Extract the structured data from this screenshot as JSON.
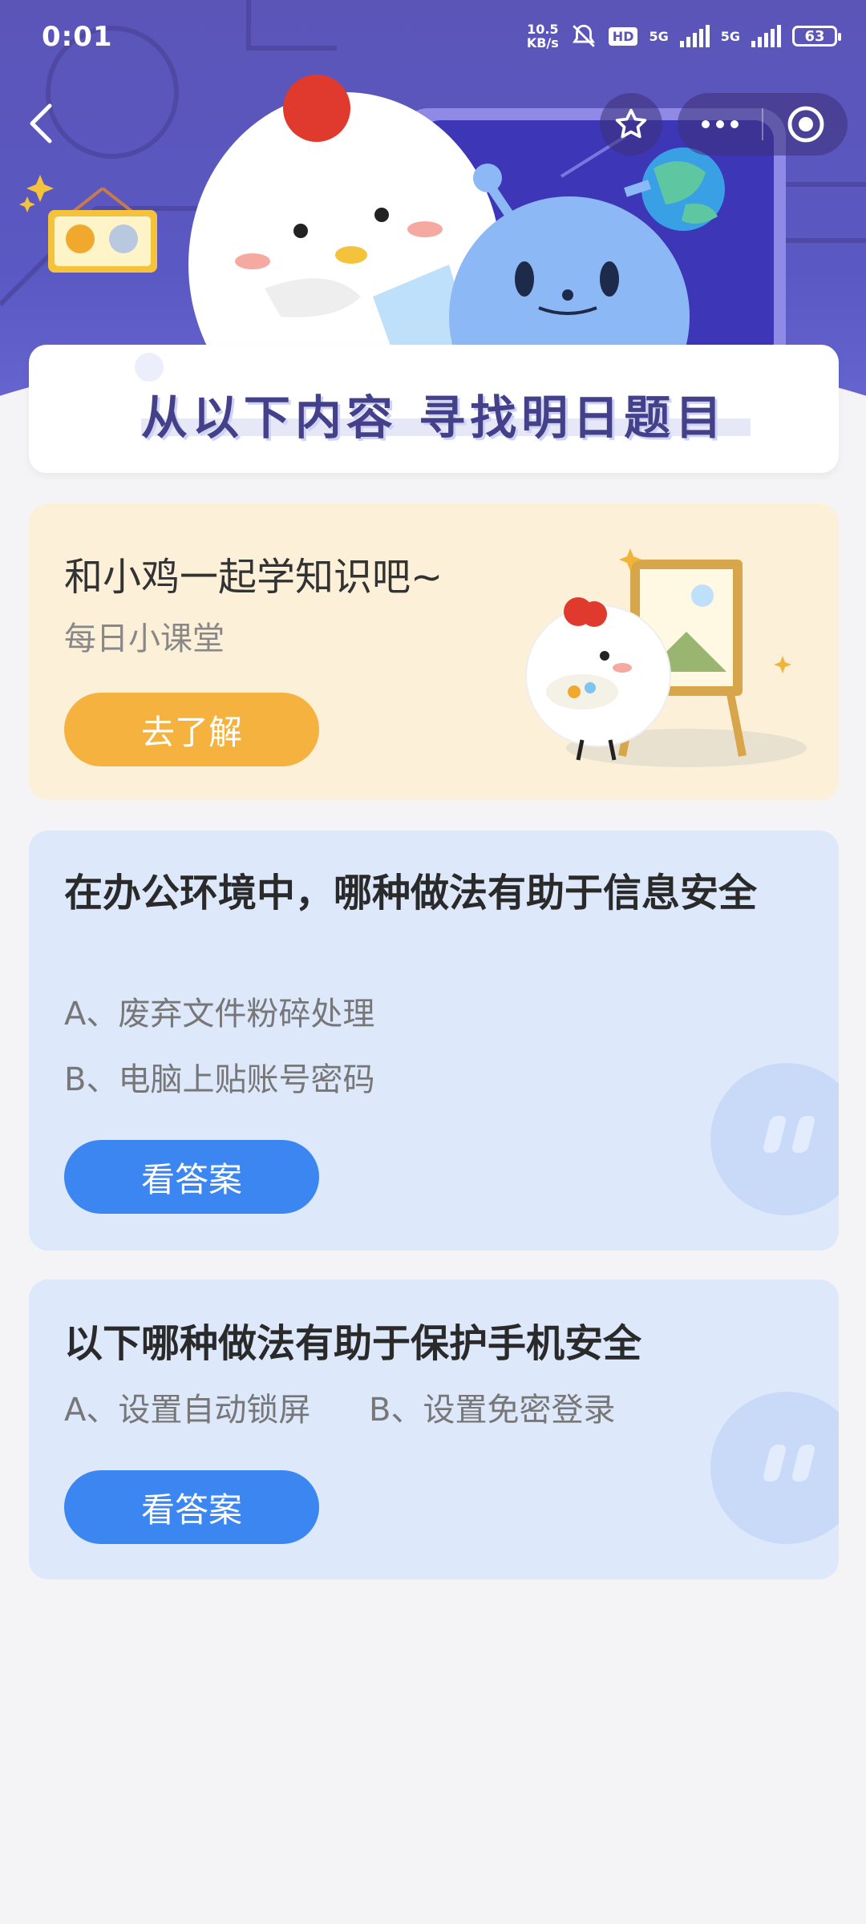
{
  "status_bar": {
    "time": "0:01",
    "net_speed_value": "10.5",
    "net_speed_unit": "KB/s",
    "hd_label": "HD",
    "net_type_1": "5G",
    "net_type_2": "5G",
    "battery": "63"
  },
  "banner": {
    "title": "从以下内容  寻找明日题目"
  },
  "learn_card": {
    "title": "和小鸡一起学知识吧~",
    "subtitle": "每日小课堂",
    "button_label": "去了解"
  },
  "questions": [
    {
      "title": "在办公环境中，哪种做法有助于信息安全",
      "option_a": "A、废弃文件粉碎处理",
      "option_b": "B、电脑上贴账号密码",
      "button_label": "看答案"
    },
    {
      "title": "以下哪种做法有助于保护手机安全",
      "option_a": "A、设置自动锁屏",
      "option_b": "B、设置免密登录",
      "button_label": "看答案"
    }
  ],
  "colors": {
    "header_purple": "#5b55b8",
    "learn_button": "#f5b23f",
    "answer_button": "#3b86f0",
    "question_card_bg": "#dde8fb",
    "learn_card_bg": "#fdf0d8"
  },
  "icons": [
    "back-arrow-icon",
    "star-icon",
    "more-dots-icon",
    "target-icon",
    "mute-bell-icon",
    "signal-icon",
    "battery-icon"
  ]
}
